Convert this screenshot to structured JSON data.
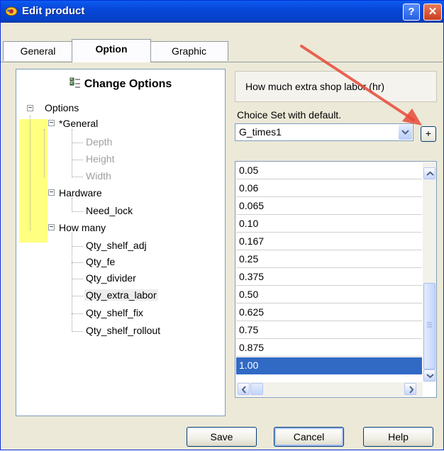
{
  "window": {
    "title": "Edit product",
    "help_glyph": "?",
    "close_glyph": "✕"
  },
  "tabs": [
    {
      "label": "General"
    },
    {
      "label": "Option"
    },
    {
      "label": "Graphic"
    }
  ],
  "left_panel": {
    "header": "Change Options",
    "tree": [
      {
        "label": "Options",
        "expander": "−"
      },
      {
        "label": "*General",
        "expander": "−"
      },
      {
        "label": "Depth",
        "disabled": true
      },
      {
        "label": "Height",
        "disabled": true
      },
      {
        "label": "Width",
        "disabled": true
      },
      {
        "label": "Hardware",
        "expander": "−"
      },
      {
        "label": "Need_lock"
      },
      {
        "label": "How many",
        "expander": "−"
      },
      {
        "label": "Qty_shelf_adj"
      },
      {
        "label": "Qty_fe"
      },
      {
        "label": "Qty_divider"
      },
      {
        "label": "Qty_extra_labor",
        "selected": true
      },
      {
        "label": "Qty_shelf_fix"
      },
      {
        "label": "Qty_shelf_rollout"
      }
    ]
  },
  "right_panel": {
    "question": "How much extra shop labor (hr)",
    "choice_label": "Choice Set with default.",
    "choice_value": "G_times1",
    "add_label": "+",
    "values": [
      "0.05",
      "0.06",
      "0.065",
      "0.10",
      "0.167",
      "0.25",
      "0.375",
      "0.50",
      "0.625",
      "0.75",
      "0.875",
      "1.00"
    ],
    "selected_value": "1.00"
  },
  "buttons": {
    "save": "Save",
    "cancel": "Cancel",
    "help": "Help"
  },
  "colors": {
    "title_bar": "#0846d8",
    "selection": "#316ac5",
    "highlight": "#ffff80",
    "annotation_arrow": "#e84a3a"
  }
}
